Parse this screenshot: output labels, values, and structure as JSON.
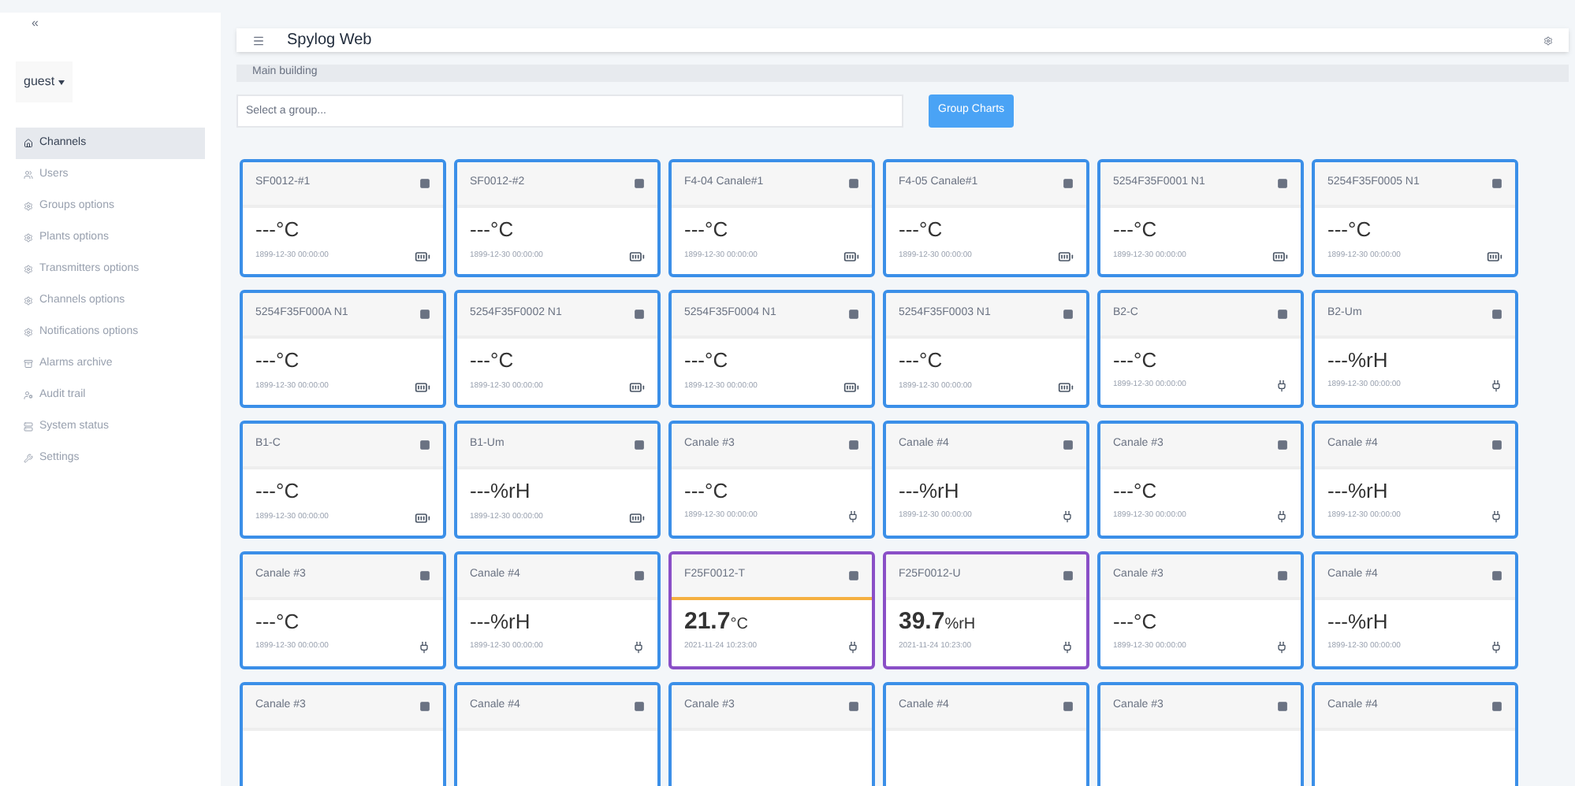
{
  "sidebar": {
    "collapse": "«",
    "user": "guest",
    "items": [
      {
        "label": "Channels",
        "selected": true
      },
      {
        "label": "Users",
        "selected": false
      },
      {
        "label": "Groups options",
        "selected": false
      },
      {
        "label": "Plants options",
        "selected": false
      },
      {
        "label": "Transmitters options",
        "selected": false
      },
      {
        "label": "Channels options",
        "selected": false
      },
      {
        "label": "Notifications options",
        "selected": false
      },
      {
        "label": "Alarms archive",
        "selected": false
      },
      {
        "label": "Audit trail",
        "selected": false
      },
      {
        "label": "System status",
        "selected": false
      },
      {
        "label": "Settings",
        "selected": false
      }
    ]
  },
  "header": {
    "title": "Spylog Web"
  },
  "breadcrumb": "Main building",
  "group_select": {
    "placeholder": "Select a group..."
  },
  "group_button": "Group Charts",
  "channels": [
    {
      "title": "SF0012-#1",
      "value": "---",
      "unit": "°C",
      "date": "1899-12-30 00:00:00",
      "kind": "battery",
      "live": false,
      "warning": false,
      "color": "#3b8fe8"
    },
    {
      "title": "SF0012-#2",
      "value": "---",
      "unit": "°C",
      "date": "1899-12-30 00:00:00",
      "kind": "battery",
      "live": false,
      "warning": false,
      "color": "#3b8fe8"
    },
    {
      "title": "F4-04 Canale#1",
      "value": "---",
      "unit": "°C",
      "date": "1899-12-30 00:00:00",
      "kind": "battery",
      "live": false,
      "warning": false,
      "color": "#3b8fe8"
    },
    {
      "title": "F4-05 Canale#1",
      "value": "---",
      "unit": "°C",
      "date": "1899-12-30 00:00:00",
      "kind": "battery",
      "live": false,
      "warning": false,
      "color": "#3b8fe8"
    },
    {
      "title": "5254F35F0001 N1",
      "value": "---",
      "unit": "°C",
      "date": "1899-12-30 00:00:00",
      "kind": "battery",
      "live": false,
      "warning": false,
      "color": "#3b8fe8"
    },
    {
      "title": "5254F35F0005 N1",
      "value": "---",
      "unit": "°C",
      "date": "1899-12-30 00:00:00",
      "kind": "battery",
      "live": false,
      "warning": false,
      "color": "#3b8fe8"
    },
    {
      "title": "5254F35F000A N1",
      "value": "---",
      "unit": "°C",
      "date": "1899-12-30 00:00:00",
      "kind": "battery",
      "live": false,
      "warning": false,
      "color": "#3b8fe8"
    },
    {
      "title": "5254F35F0002 N1",
      "value": "---",
      "unit": "°C",
      "date": "1899-12-30 00:00:00",
      "kind": "battery",
      "live": false,
      "warning": false,
      "color": "#3b8fe8"
    },
    {
      "title": "5254F35F0004 N1",
      "value": "---",
      "unit": "°C",
      "date": "1899-12-30 00:00:00",
      "kind": "battery",
      "live": false,
      "warning": false,
      "color": "#3b8fe8"
    },
    {
      "title": "5254F35F0003 N1",
      "value": "---",
      "unit": "°C",
      "date": "1899-12-30 00:00:00",
      "kind": "battery",
      "live": false,
      "warning": false,
      "color": "#3b8fe8"
    },
    {
      "title": "B2-C",
      "value": "---",
      "unit": "°C",
      "date": "1899-12-30 00:00:00",
      "kind": "plug",
      "live": false,
      "warning": false,
      "color": "#3b8fe8"
    },
    {
      "title": "B2-Um",
      "value": "---",
      "unit": "%rH",
      "date": "1899-12-30 00:00:00",
      "kind": "plug",
      "live": false,
      "warning": false,
      "color": "#3b8fe8"
    },
    {
      "title": "B1-C",
      "value": "---",
      "unit": "°C",
      "date": "1899-12-30 00:00:00",
      "kind": "battery",
      "live": false,
      "warning": false,
      "color": "#3b8fe8"
    },
    {
      "title": "B1-Um",
      "value": "---",
      "unit": "%rH",
      "date": "1899-12-30 00:00:00",
      "kind": "battery",
      "live": false,
      "warning": false,
      "color": "#3b8fe8"
    },
    {
      "title": "Canale #3",
      "value": "---",
      "unit": "°C",
      "date": "1899-12-30 00:00:00",
      "kind": "plug",
      "live": false,
      "warning": false,
      "color": "#3b8fe8"
    },
    {
      "title": "Canale #4",
      "value": "---",
      "unit": "%rH",
      "date": "1899-12-30 00:00:00",
      "kind": "plug",
      "live": false,
      "warning": false,
      "color": "#3b8fe8"
    },
    {
      "title": "Canale #3",
      "value": "---",
      "unit": "°C",
      "date": "1899-12-30 00:00:00",
      "kind": "plug",
      "live": false,
      "warning": false,
      "color": "#3b8fe8"
    },
    {
      "title": "Canale #4",
      "value": "---",
      "unit": "%rH",
      "date": "1899-12-30 00:00:00",
      "kind": "plug",
      "live": false,
      "warning": false,
      "color": "#3b8fe8"
    },
    {
      "title": "Canale #3",
      "value": "---",
      "unit": "°C",
      "date": "1899-12-30 00:00:00",
      "kind": "plug",
      "live": false,
      "warning": false,
      "color": "#3b8fe8"
    },
    {
      "title": "Canale #4",
      "value": "---",
      "unit": "%rH",
      "date": "1899-12-30 00:00:00",
      "kind": "plug",
      "live": false,
      "warning": false,
      "color": "#3b8fe8"
    },
    {
      "title": "F25F0012-T",
      "value": "21.7",
      "unit": "°C",
      "date": "2021-11-24 10:23:00",
      "kind": "plug",
      "live": true,
      "warning": true,
      "color": "#8a4fc7"
    },
    {
      "title": "F25F0012-U",
      "value": "39.7",
      "unit": "%rH",
      "date": "2021-11-24 10:23:00",
      "kind": "plug",
      "live": true,
      "warning": false,
      "color": "#8a4fc7"
    },
    {
      "title": "Canale #3",
      "value": "---",
      "unit": "°C",
      "date": "1899-12-30 00:00:00",
      "kind": "plug",
      "live": false,
      "warning": false,
      "color": "#3b8fe8"
    },
    {
      "title": "Canale #4",
      "value": "---",
      "unit": "%rH",
      "date": "1899-12-30 00:00:00",
      "kind": "plug",
      "live": false,
      "warning": false,
      "color": "#3b8fe8"
    },
    {
      "title": "Canale #3",
      "color": "#3b8fe8"
    },
    {
      "title": "Canale #4",
      "color": "#3b8fe8"
    },
    {
      "title": "Canale #3",
      "color": "#3b8fe8"
    },
    {
      "title": "Canale #4",
      "color": "#3b8fe8"
    },
    {
      "title": "Canale #3",
      "color": "#3b8fe8"
    },
    {
      "title": "Canale #4",
      "color": "#3b8fe8"
    }
  ]
}
